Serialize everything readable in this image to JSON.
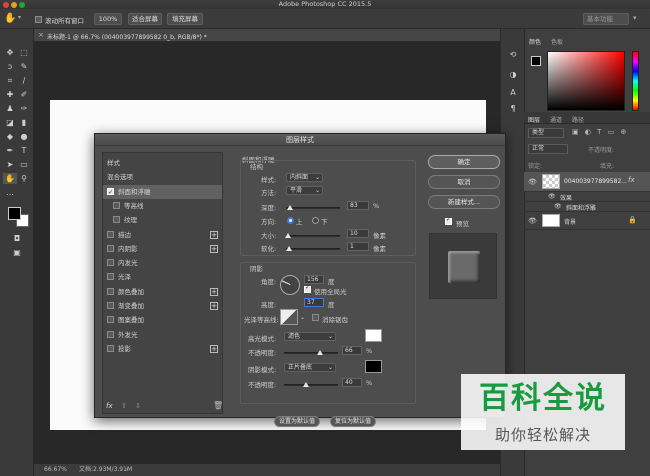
{
  "window": {
    "title": "Adobe Photoshop CC 2015.5"
  },
  "options_bar": {
    "scroll_all_label": "滚动所有窗口",
    "zoom_value": "100%",
    "fit_label": "适合屏幕",
    "fill_label": "填充屏幕",
    "workspace": "基本功能"
  },
  "document_tab": {
    "title": "未标题-1 @ 66.7% (004003977899582 0_b, RGB/8*) *"
  },
  "status_bar": {
    "zoom": "66.67%",
    "doc_size": "文档:2.93M/3.91M"
  },
  "right_panel": {
    "color_tabs": [
      "颜色",
      "色板"
    ],
    "layer_tabs": [
      "图层",
      "通道",
      "路径"
    ],
    "filter_kind": "类型",
    "blend_mode": "正常",
    "opacity_label": "不透明度:",
    "fill_label": "填充:",
    "lock_label": "锁定:",
    "layers": [
      {
        "name": "004003977899582...",
        "fx": "fx"
      },
      {
        "name": "效果"
      },
      {
        "name": "斜面和浮雕"
      },
      {
        "name": "背景"
      }
    ]
  },
  "dialog": {
    "title": "图层样式",
    "style_list": [
      {
        "label": "样式",
        "check": false,
        "plus": false,
        "indent": 0,
        "has_check": false
      },
      {
        "label": "混合选项",
        "check": false,
        "plus": false,
        "indent": 0,
        "has_check": false
      },
      {
        "label": "斜面和浮雕",
        "check": true,
        "plus": false,
        "indent": 0,
        "has_check": true,
        "selected": true
      },
      {
        "label": "等高线",
        "check": false,
        "plus": false,
        "indent": 1,
        "has_check": true
      },
      {
        "label": "纹理",
        "check": false,
        "plus": false,
        "indent": 1,
        "has_check": true
      },
      {
        "label": "描边",
        "check": false,
        "plus": true,
        "indent": 0,
        "has_check": true
      },
      {
        "label": "内阴影",
        "check": false,
        "plus": true,
        "indent": 0,
        "has_check": true
      },
      {
        "label": "内发光",
        "check": false,
        "plus": false,
        "indent": 0,
        "has_check": true
      },
      {
        "label": "光泽",
        "check": false,
        "plus": false,
        "indent": 0,
        "has_check": true
      },
      {
        "label": "颜色叠加",
        "check": false,
        "plus": true,
        "indent": 0,
        "has_check": true
      },
      {
        "label": "渐变叠加",
        "check": false,
        "plus": true,
        "indent": 0,
        "has_check": true
      },
      {
        "label": "图案叠加",
        "check": false,
        "plus": false,
        "indent": 0,
        "has_check": true
      },
      {
        "label": "外发光",
        "check": false,
        "plus": false,
        "indent": 0,
        "has_check": true
      },
      {
        "label": "投影",
        "check": false,
        "plus": true,
        "indent": 0,
        "has_check": true
      }
    ],
    "fx_label": "fx",
    "bevel": {
      "section": "斜面和浮雕",
      "structure": "结构",
      "style_label": "样式:",
      "style_value": "内斜面",
      "technique_label": "方法:",
      "technique_value": "平滑",
      "depth_label": "深度:",
      "depth_value": "83",
      "depth_unit": "%",
      "depth_level": 0.083,
      "direction_label": "方向:",
      "dir_up": "上",
      "dir_down": "下",
      "size_label": "大小:",
      "size_value": "10",
      "size_unit": "像素",
      "size_level": 0.04,
      "soften_label": "软化:",
      "soften_value": "1",
      "soften_unit": "像素",
      "soften_level": 0.06
    },
    "shading": {
      "section": "阴影",
      "angle_label": "角度:",
      "angle_value": "156",
      "angle_unit": "度",
      "global_light_label": "使用全局光",
      "altitude_label": "高度:",
      "altitude_value": "37",
      "altitude_unit": "度",
      "gloss_label": "光泽等高线:",
      "antialias_label": "消除锯齿",
      "highlight_mode_label": "高光模式:",
      "highlight_mode": "滤色",
      "hl_opacity_label": "不透明度:",
      "hl_opacity": "66",
      "hl_unit": "%",
      "hl_level": 0.66,
      "shadow_mode_label": "阴影模式:",
      "shadow_mode": "正片叠底",
      "sh_opacity_label": "不透明度:",
      "sh_opacity": "40",
      "sh_unit": "%",
      "sh_level": 0.4,
      "highlight_color": "#ffffff",
      "shadow_color": "#000000"
    },
    "set_default": "设置为默认值",
    "reset_default": "复位为默认值",
    "ok": "确定",
    "cancel": "取消",
    "new_style": "新建样式...",
    "preview_label": "预览"
  },
  "watermark": {
    "title": "百科全说",
    "subtitle": "助你轻松解决",
    "color": "#1a9a3f"
  }
}
